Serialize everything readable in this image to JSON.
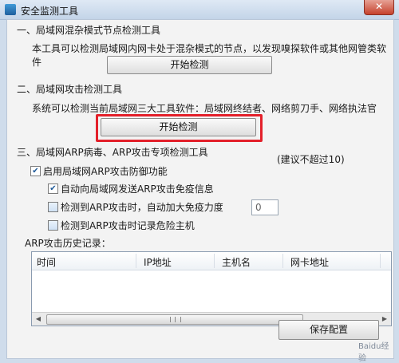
{
  "window": {
    "title": "安全监测工具",
    "close_glyph": "✕"
  },
  "section1": {
    "heading": "一、局域网混杂模式节点检测工具",
    "description": "本工具可以检测局域网内网卡处于混杂模式的节点，以发现嗅探软件或其他网管类软件",
    "button_label": "开始检测"
  },
  "section2": {
    "heading": "二、局域网攻击检测工具",
    "description": "系统可以检测当前局域网三大工具软件：局域网终结者、网络剪刀手、网络执法官",
    "button_label": "开始检测"
  },
  "section3": {
    "heading": "三、局域网ARP病毒、ARP攻击专项检测工具",
    "note": "(建议不超过10)",
    "options": [
      {
        "label": "启用局域网ARP攻击防御功能",
        "checked": true
      },
      {
        "label": "自动向局域网发送ARP攻击免疫信息",
        "checked": true
      },
      {
        "label": "检测到ARP攻击时，自动加大免疫力度",
        "checked": false
      },
      {
        "label": "检测到ARP攻击时记录危险主机",
        "checked": false
      }
    ],
    "immunity_value": "0",
    "history_title": "ARP攻击历史记录：",
    "columns": [
      "时间",
      "IP地址",
      "主机名",
      "网卡地址"
    ],
    "save_label": "保存配置"
  },
  "watermark": "Baidu经验"
}
